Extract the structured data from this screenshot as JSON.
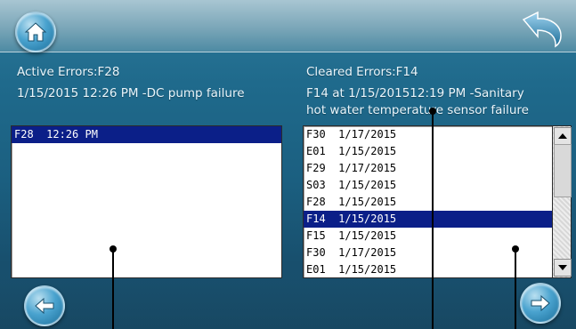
{
  "colors": {
    "selection": "#0b1f88",
    "background": "#1f6a8c",
    "text": "#e9f5fb"
  },
  "header": {
    "home_icon": "home-icon",
    "undo_icon": "undo-arrow-icon"
  },
  "active": {
    "title": "Active Errors:F28",
    "detail": "1/15/2015 12:26 PM -DC pump failure",
    "list": [
      {
        "text": "F28  12:26 PM",
        "selected": true
      }
    ]
  },
  "cleared": {
    "title": "Cleared Errors:F14",
    "detail_line1": "F14 at  1/15/201512:19 PM -Sanitary",
    "detail_line2": "hot water temperature sensor failure",
    "list": [
      {
        "text": "F30  1/17/2015",
        "selected": false
      },
      {
        "text": "E01  1/15/2015",
        "selected": false
      },
      {
        "text": "F29  1/17/2015",
        "selected": false
      },
      {
        "text": "S03  1/15/2015",
        "selected": false
      },
      {
        "text": "F28  1/15/2015",
        "selected": false
      },
      {
        "text": "F14  1/15/2015",
        "selected": true
      },
      {
        "text": "F15  1/15/2015",
        "selected": false
      },
      {
        "text": "F30  1/17/2015",
        "selected": false
      },
      {
        "text": "E01  1/15/2015",
        "selected": false
      }
    ]
  },
  "footer": {
    "prev_icon": "left-arrow-icon",
    "next_icon": "right-arrow-icon"
  }
}
